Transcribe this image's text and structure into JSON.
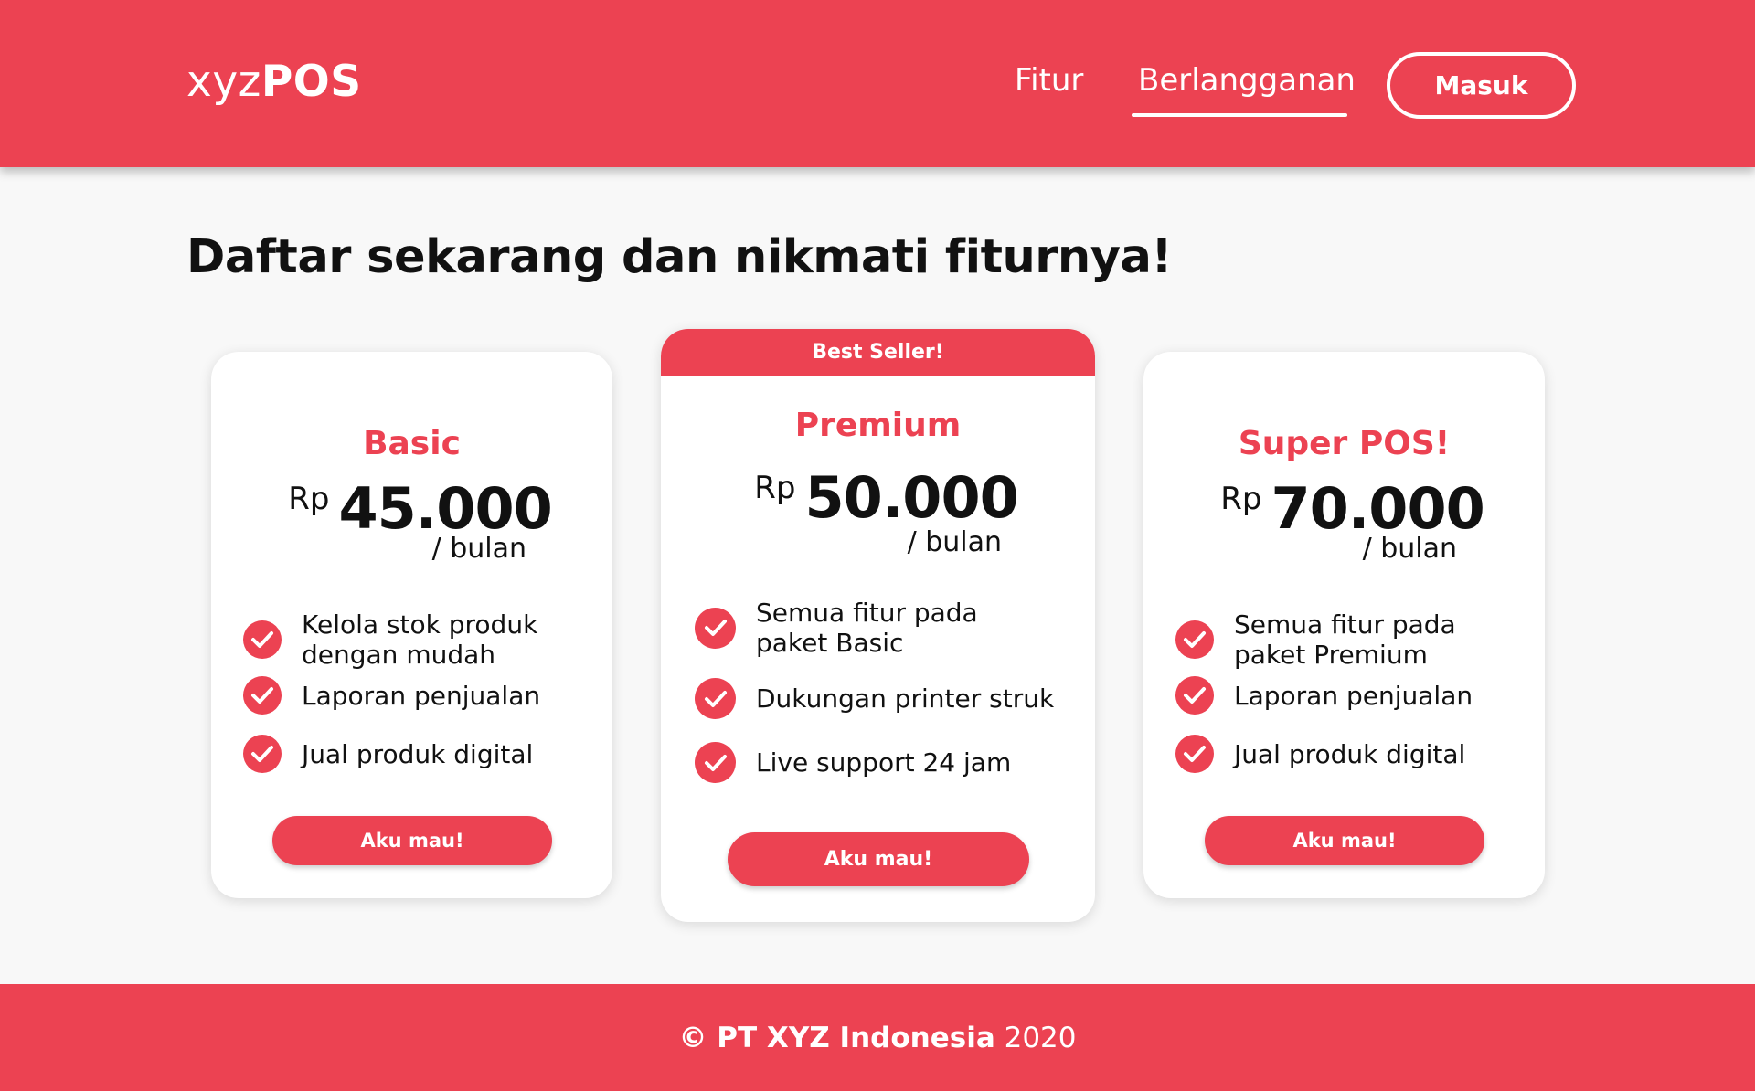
{
  "header": {
    "logo_light": "xyz",
    "logo_bold": "POS",
    "nav": [
      {
        "label": "Fitur"
      },
      {
        "label": "Berlangganan"
      }
    ],
    "login_label": "Masuk"
  },
  "main": {
    "headline": "Daftar sekarang dan nikmati fiturnya!",
    "plans": [
      {
        "name": "Basic",
        "currency": "Rp",
        "amount": "45.000",
        "per": "/ bulan",
        "features": [
          "Kelola stok produk dengan mudah",
          "Laporan penjualan",
          "Jual produk digital"
        ],
        "cta": "Aku mau!"
      },
      {
        "badge": "Best Seller!",
        "name": "Premium",
        "currency": "Rp",
        "amount": "50.000",
        "per": "/ bulan",
        "features": [
          "Semua fitur pada paket Basic",
          "Dukungan printer struk",
          "Live support 24 jam"
        ],
        "cta": "Aku mau!"
      },
      {
        "name": "Super POS!",
        "currency": "Rp",
        "amount": "70.000",
        "per": "/ bulan",
        "features": [
          "Semua fitur pada paket Premium",
          "Laporan penjualan",
          "Jual produk digital"
        ],
        "cta": "Aku mau!"
      }
    ]
  },
  "footer": {
    "copyright_bold": "© PT XYZ Indonesia",
    "year": "2020"
  },
  "colors": {
    "accent": "#ec4252",
    "background": "#f8f8f8",
    "card": "#ffffff"
  },
  "icons": {
    "feature_check": "check-circle-icon"
  }
}
